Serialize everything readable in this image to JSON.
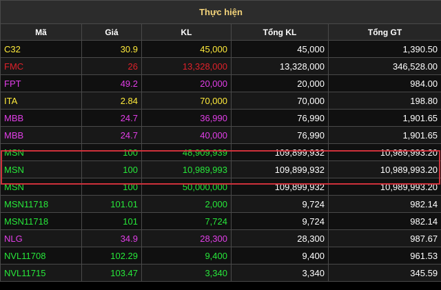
{
  "board": {
    "title": "Thực hiện",
    "columns": [
      "Mã",
      "Giá",
      "KL",
      "Tổng KL",
      "Tổng GT"
    ],
    "colors": {
      "yellow": "#ffeb3b",
      "red": "#e0212a",
      "magenta": "#e23ee8",
      "green": "#27e83a",
      "highlight_border": "#d0313b",
      "title_text": "#f3d37a"
    },
    "rows": [
      {
        "symbol": "C32",
        "price": "30.9",
        "volume": "45,000",
        "total_volume": "45,000",
        "total_value": "1,390.50",
        "color": "yellow"
      },
      {
        "symbol": "FMC",
        "price": "26",
        "volume": "13,328,000",
        "total_volume": "13,328,000",
        "total_value": "346,528.00",
        "color": "red"
      },
      {
        "symbol": "FPT",
        "price": "49.2",
        "volume": "20,000",
        "total_volume": "20,000",
        "total_value": "984.00",
        "color": "magenta"
      },
      {
        "symbol": "ITA",
        "price": "2.84",
        "volume": "70,000",
        "total_volume": "70,000",
        "total_value": "198.80",
        "color": "yellow"
      },
      {
        "symbol": "MBB",
        "price": "24.7",
        "volume": "36,990",
        "total_volume": "76,990",
        "total_value": "1,901.65",
        "color": "magenta"
      },
      {
        "symbol": "MBB",
        "price": "24.7",
        "volume": "40,000",
        "total_volume": "76,990",
        "total_value": "1,901.65",
        "color": "magenta"
      },
      {
        "symbol": "MSN",
        "price": "100",
        "volume": "48,909,939",
        "total_volume": "109,899,932",
        "total_value": "10,989,993.20",
        "color": "green"
      },
      {
        "symbol": "MSN",
        "price": "100",
        "volume": "10,989,993",
        "total_volume": "109,899,932",
        "total_value": "10,989,993.20",
        "color": "green"
      },
      {
        "symbol": "MSN",
        "price": "100",
        "volume": "50,000,000",
        "total_volume": "109,899,932",
        "total_value": "10,989,993.20",
        "color": "green"
      },
      {
        "symbol": "MSN11718",
        "price": "101.01",
        "volume": "2,000",
        "total_volume": "9,724",
        "total_value": "982.14",
        "color": "green"
      },
      {
        "symbol": "MSN11718",
        "price": "101",
        "volume": "7,724",
        "total_volume": "9,724",
        "total_value": "982.14",
        "color": "green"
      },
      {
        "symbol": "NLG",
        "price": "34.9",
        "volume": "28,300",
        "total_volume": "28,300",
        "total_value": "987.67",
        "color": "magenta"
      },
      {
        "symbol": "NVL11708",
        "price": "102.29",
        "volume": "9,400",
        "total_volume": "9,400",
        "total_value": "961.53",
        "color": "green"
      },
      {
        "symbol": "NVL11715",
        "price": "103.47",
        "volume": "3,340",
        "total_volume": "3,340",
        "total_value": "345.59",
        "color": "green"
      }
    ]
  }
}
